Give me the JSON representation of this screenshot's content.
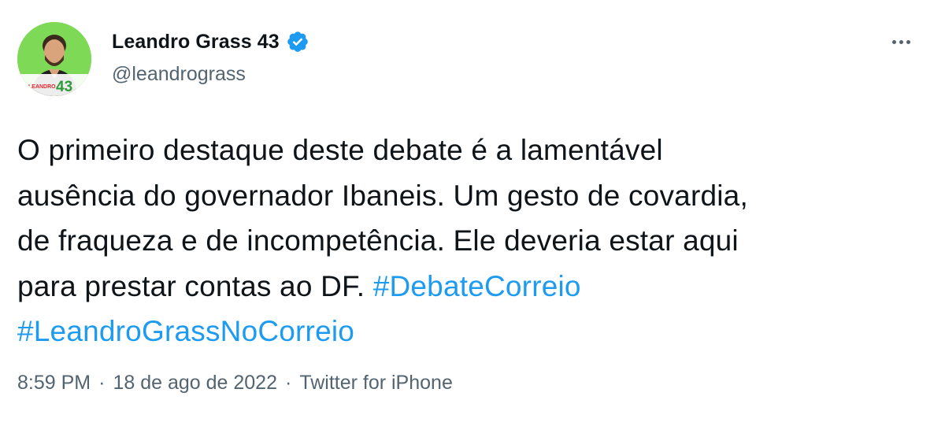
{
  "author": {
    "display_name": "Leandro Grass 43",
    "handle": "@leandrograss",
    "verified": true,
    "avatar_badge_text": "43",
    "avatar_logo_text": "LEANDRO"
  },
  "tweet": {
    "text_lines": [
      "O primeiro destaque deste debate é a lamentável",
      "ausência do governador Ibaneis. Um gesto de covardia,",
      "de fraqueza e de incompetência. Ele deveria estar aqui",
      "para prestar contas ao DF. "
    ],
    "hashtags": [
      "#DebateCorreio",
      "#LeandroGrassNoCorreio"
    ]
  },
  "meta": {
    "time": "8:59 PM",
    "separator": "·",
    "date": "18 de ago de 2022",
    "source": "Twitter for iPhone"
  },
  "colors": {
    "link": "#1d9bf0",
    "verified": "#1d9bf0",
    "secondary_text": "#536471",
    "primary_text": "#0f1419",
    "avatar_bg": "#7ed957"
  },
  "icons": {
    "verified": "verified-badge-icon",
    "more": "more-horizontal-icon"
  }
}
